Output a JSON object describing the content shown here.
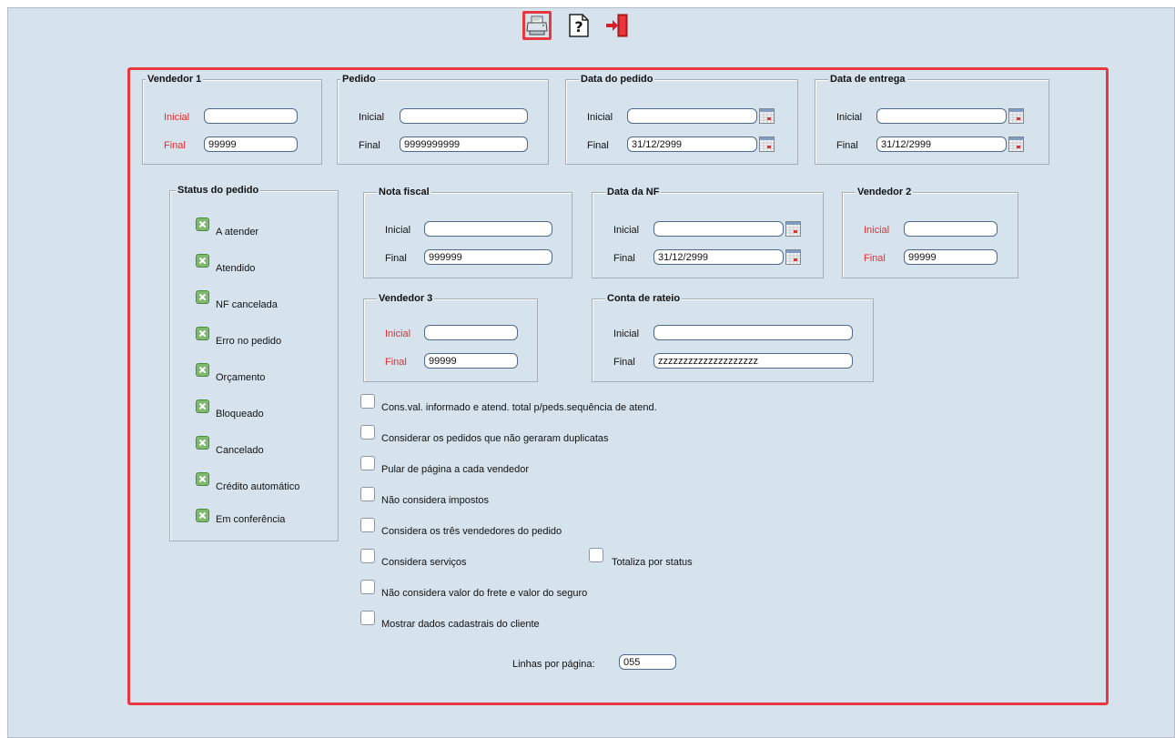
{
  "toolbar": {
    "print_icon": "printer-icon",
    "help_icon": "help-icon",
    "exit_icon": "exit-door-icon"
  },
  "accent": "#e8373f",
  "vendedor1": {
    "legend": "Vendedor 1",
    "initial_label": "Inicial",
    "final_label": "Final",
    "initial_value": "",
    "final_value": "99999"
  },
  "pedido": {
    "legend": "Pedido",
    "initial_label": "Inicial",
    "final_label": "Final",
    "initial_value": "",
    "final_value": "9999999999"
  },
  "data_pedido": {
    "legend": "Data do pedido",
    "initial_label": "Inicial",
    "final_label": "Final",
    "initial_value": "",
    "final_value": "31/12/2999"
  },
  "data_entrega": {
    "legend": "Data de entrega",
    "initial_label": "Inicial",
    "final_label": "Final",
    "initial_value": "",
    "final_value": "31/12/2999"
  },
  "status": {
    "legend": "Status do pedido",
    "items": [
      {
        "label": "A atender",
        "checked": true
      },
      {
        "label": "Atendido",
        "checked": true
      },
      {
        "label": "NF cancelada",
        "checked": true
      },
      {
        "label": "Erro no pedido",
        "checked": true
      },
      {
        "label": "Orçamento",
        "checked": true
      },
      {
        "label": "Bloqueado",
        "checked": true
      },
      {
        "label": "Cancelado",
        "checked": true
      },
      {
        "label": "Crédito automático",
        "checked": true
      },
      {
        "label": "Em conferência",
        "checked": true
      }
    ]
  },
  "nota_fiscal": {
    "legend": "Nota fiscal",
    "initial_label": "Inicial",
    "final_label": "Final",
    "initial_value": "",
    "final_value": "999999"
  },
  "data_nf": {
    "legend": "Data da NF",
    "initial_label": "Inicial",
    "final_label": "Final",
    "initial_value": "",
    "final_value": "31/12/2999"
  },
  "vendedor2": {
    "legend": "Vendedor 2",
    "initial_label": "Inicial",
    "final_label": "Final",
    "initial_value": "",
    "final_value": "99999"
  },
  "vendedor3": {
    "legend": "Vendedor 3",
    "initial_label": "Inicial",
    "final_label": "Final",
    "initial_value": "",
    "final_value": "99999"
  },
  "conta_rateio": {
    "legend": "Conta de rateio",
    "initial_label": "Inicial",
    "final_label": "Final",
    "initial_value": "",
    "final_value": "zzzzzzzzzzzzzzzzzzzz"
  },
  "options": [
    {
      "label": "Cons.val. informado e atend. total p/peds.sequência de atend.",
      "checked": false
    },
    {
      "label": "Considerar os pedidos que não geraram duplicatas",
      "checked": false
    },
    {
      "label": "Pular de página a cada vendedor",
      "checked": false
    },
    {
      "label": "Não considera impostos",
      "checked": false
    },
    {
      "label": "Considera os três vendedores do pedido",
      "checked": false
    },
    {
      "label": "Considera serviços",
      "checked": false
    },
    {
      "label": "Totaliza por status",
      "checked": false
    },
    {
      "label": "Não considera valor do frete e valor do seguro",
      "checked": false
    },
    {
      "label": "Mostrar dados cadastrais do cliente",
      "checked": false
    }
  ],
  "linhas": {
    "label": "Linhas por página:",
    "value": "055"
  }
}
